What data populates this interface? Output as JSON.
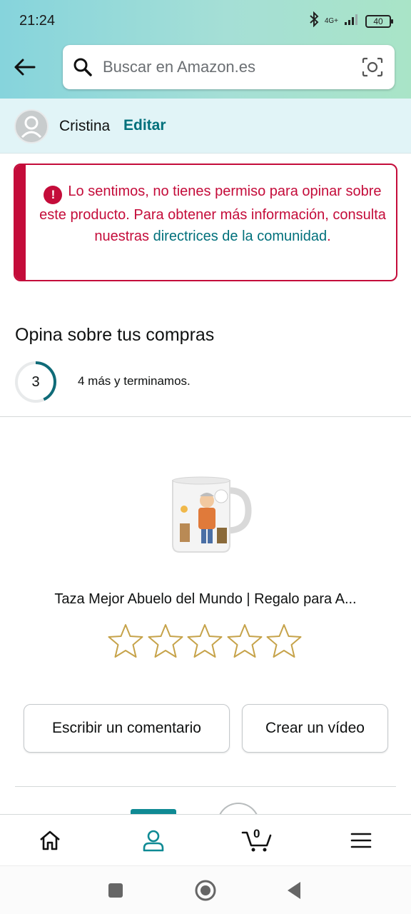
{
  "status_bar": {
    "time": "21:24",
    "network": "4G+",
    "battery": "40"
  },
  "search": {
    "placeholder": "Buscar en Amazon.es"
  },
  "user": {
    "name": "Cristina",
    "edit_label": "Editar"
  },
  "alert": {
    "message": "Lo sentimos, no tienes permiso para opinar sobre este producto. Para obtener más información, consulta nuestras ",
    "link_text": "directrices de la comunidad",
    "tail": "."
  },
  "review_section": {
    "title": "Opina sobre tus compras",
    "progress_count": "3",
    "progress_text": "4 más y terminamos.",
    "progress_fraction": 0.43
  },
  "product": {
    "title": "Taza Mejor Abuelo del Mundo | Regalo para A...",
    "rating_stars": 0,
    "max_stars": 5
  },
  "actions": {
    "write_review": "Escribir un comentario",
    "create_video": "Crear un vídeo"
  },
  "bottom_nav": {
    "cart_count": "0",
    "active": "account",
    "active_color": "#0f8a94"
  },
  "colors": {
    "accent": "#00707b",
    "error": "#c40c3a",
    "star": "#c6a34a"
  }
}
